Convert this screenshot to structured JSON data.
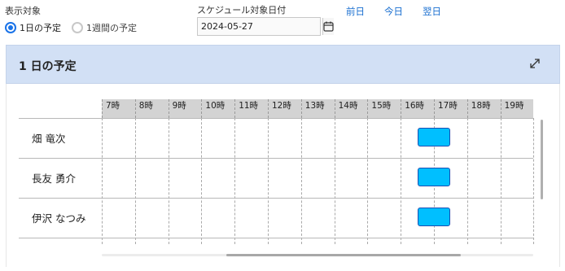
{
  "filter": {
    "label": "表示対象",
    "options": [
      {
        "label": "1日の予定",
        "selected": true
      },
      {
        "label": "1週間の予定",
        "selected": false
      }
    ]
  },
  "date": {
    "label": "スケジュール対象日付",
    "value": "2024-05-27"
  },
  "nav": {
    "prev": "前日",
    "today": "今日",
    "next": "翌日"
  },
  "panel": {
    "title": "1 日の予定"
  },
  "timeline": {
    "hours": [
      "7時",
      "8時",
      "9時",
      "10時",
      "11時",
      "12時",
      "13時",
      "14時",
      "15時",
      "16時",
      "17時",
      "18時",
      "19時"
    ],
    "rows": [
      {
        "name": "畑 竜次",
        "event_start_hour": 16.5,
        "event_end_hour": 17.5
      },
      {
        "name": "長友 勇介",
        "event_start_hour": 16.5,
        "event_end_hour": 17.5
      },
      {
        "name": "伊沢 なつみ",
        "event_start_hour": 16.5,
        "event_end_hour": 17.5
      }
    ]
  },
  "colors": {
    "accent": "#1a73e8",
    "link": "#1a6fd0",
    "panel_header": "#d2e0f5",
    "event_fill": "#00bfff",
    "event_border": "#1a4fb3"
  }
}
